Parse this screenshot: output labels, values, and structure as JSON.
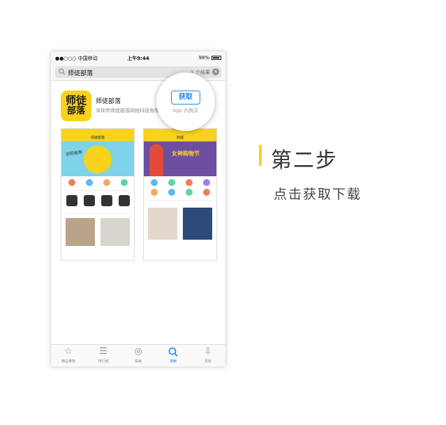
{
  "status_bar": {
    "carrier": "●●○○○ 中国移动",
    "time": "上午9:44",
    "battery": "98%"
  },
  "search": {
    "query": "师徒部落",
    "result_count": "1 个结果"
  },
  "app": {
    "name": "师徒部落",
    "developer": "深圳市师徒部落网络科技有限公司",
    "icon_text_1": "师徒",
    "icon_text_2": "部落"
  },
  "screenshot_1": {
    "banner_text": "宗师推荐",
    "nav_title": "师徒部落"
  },
  "screenshot_2": {
    "banner_text": "女神购物节",
    "nav_title": "商城"
  },
  "get_button": {
    "label": "获取",
    "iap_note": "App 内购买"
  },
  "tabs": [
    {
      "label": "精品推荐",
      "icon": "star-icon"
    },
    {
      "label": "排行榜",
      "icon": "list-icon"
    },
    {
      "label": "探索",
      "icon": "compass-icon"
    },
    {
      "label": "搜索",
      "icon": "search-icon"
    },
    {
      "label": "更新",
      "icon": "download-icon"
    }
  ],
  "active_tab": "搜索",
  "step": {
    "title": "第二步",
    "description": "点击获取下载"
  },
  "colors": {
    "accent": "#1e88e5",
    "brand_yellow": "#f8d21c"
  }
}
